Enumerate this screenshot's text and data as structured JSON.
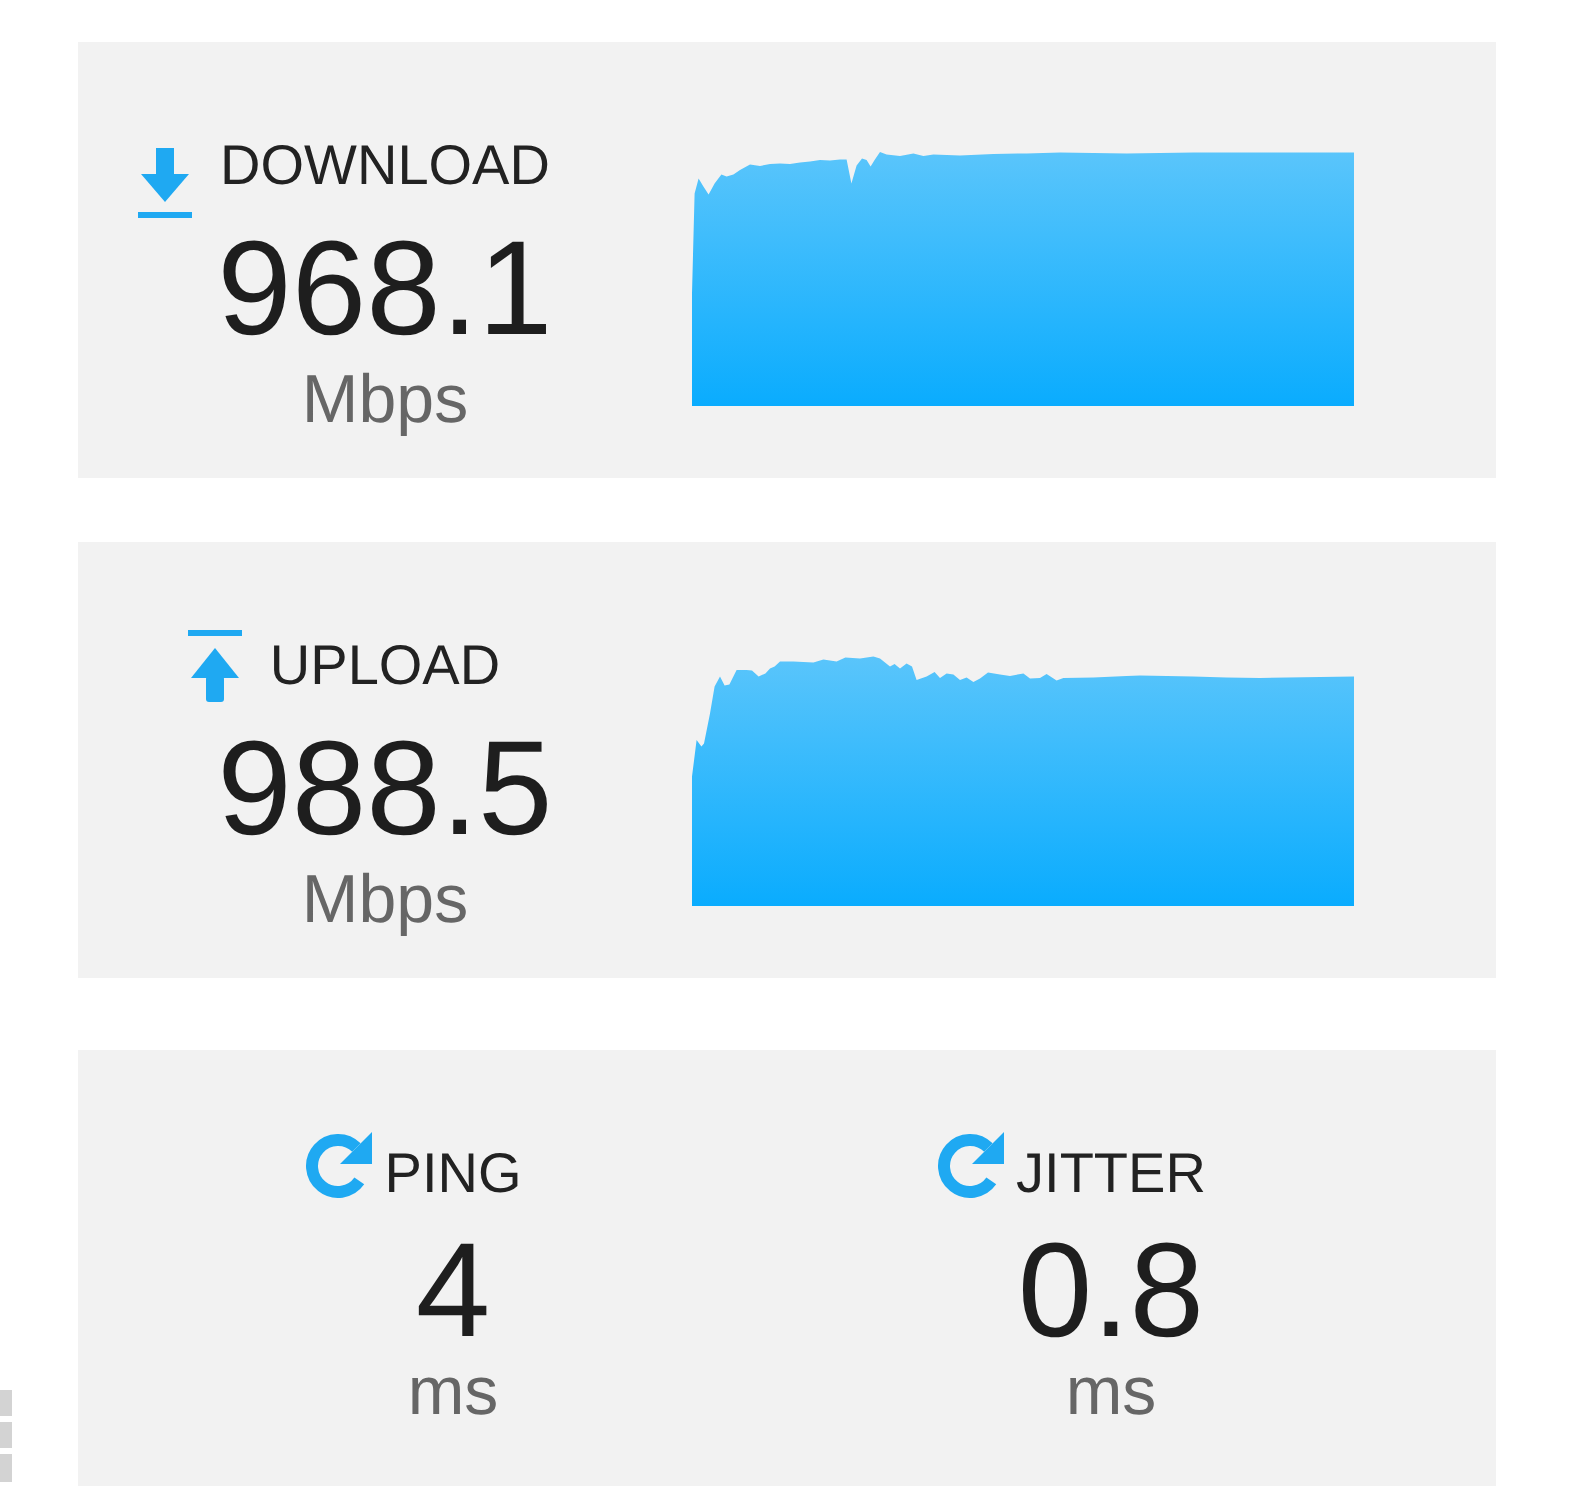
{
  "speed_panels": [
    {
      "kind": "download",
      "label": "DOWNLOAD",
      "value": "968.1",
      "unit": "Mbps"
    },
    {
      "kind": "upload",
      "label": "UPLOAD",
      "value": "988.5",
      "unit": "Mbps"
    }
  ],
  "latency_panel": {
    "metrics": [
      {
        "label": "PING",
        "value": "4",
        "unit": "ms"
      },
      {
        "label": "JITTER",
        "value": "0.8",
        "unit": "ms"
      }
    ]
  }
}
